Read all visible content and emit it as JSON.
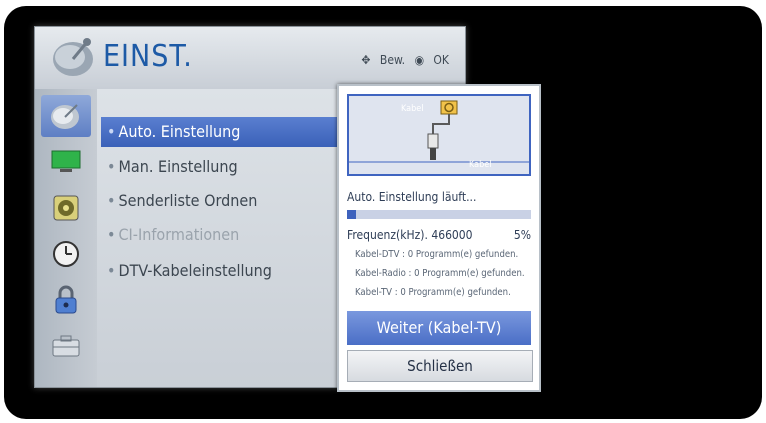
{
  "menu": {
    "title": "EINST.",
    "hint_move": "Bew.",
    "hint_ok": "OK",
    "sidebar_icons": [
      "satellite-icon",
      "tv-screen-icon",
      "speaker-icon",
      "clock-icon",
      "lock-icon",
      "toolbox-icon"
    ],
    "items": [
      {
        "label": "Auto. Einstellung",
        "state": "active"
      },
      {
        "label": "Man. Einstellung",
        "state": "normal"
      },
      {
        "label": "Senderliste Ordnen",
        "state": "normal"
      },
      {
        "label": "CI-Informationen",
        "state": "disabled"
      },
      {
        "label": "DTV-Kabeleinstellung",
        "state": "normal"
      }
    ]
  },
  "popup": {
    "illustration": {
      "source_label": "Kabel",
      "connector_label": "Kabel"
    },
    "status": "Auto. Einstellung läuft...",
    "progress_percent": 5,
    "frequency": "Frequenz(kHz). 466000",
    "percent_label": "5%",
    "results": [
      "Kabel-DTV : 0 Programm(e) gefunden.",
      "Kabel-Radio : 0 Programm(e) gefunden.",
      "Kabel-TV : 0 Programm(e) gefunden."
    ],
    "primary_button": "Weiter (Kabel-TV)",
    "secondary_button": "Schließen"
  },
  "colors": {
    "accent_blue": "#3a61b8",
    "title_blue": "#1d5aa6"
  }
}
